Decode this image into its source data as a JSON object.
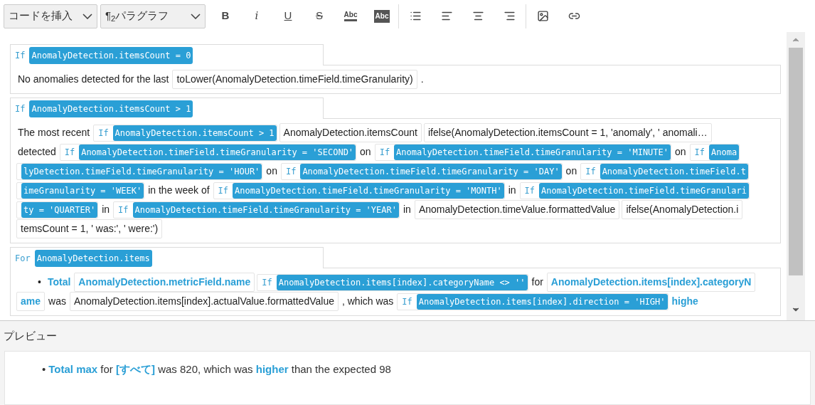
{
  "toolbar": {
    "selects": [
      {
        "label": "コードを挿入"
      },
      {
        "label": "¶$_{2}$パラグラフ"
      }
    ],
    "buttons": [
      {
        "kind": "bold",
        "label": "B"
      },
      {
        "kind": "italic",
        "label": "i"
      },
      {
        "kind": "underline",
        "label": "U"
      },
      {
        "kind": "strike",
        "label": "S"
      },
      {
        "kind": "text-color",
        "label": "Abc"
      },
      {
        "kind": "highlight",
        "label": "Abc"
      },
      {
        "kind": "list"
      },
      {
        "kind": "align-left"
      },
      {
        "kind": "align-center"
      },
      {
        "kind": "align-right"
      },
      {
        "kind": "image"
      },
      {
        "kind": "link"
      }
    ]
  },
  "editor": {
    "blocks": [
      {
        "keyword": "If",
        "condition": "AnomalyDetection.itemsCount = 0",
        "lines": [
          [
            {
              "kind": "text",
              "text": "No anomalies detected for the last"
            },
            {
              "kind": "expr",
              "text": "toLower(AnomalyDetection.timeField.timeGranularity)"
            },
            {
              "kind": "text",
              "text": "."
            }
          ]
        ]
      },
      {
        "keyword": "If",
        "condition": "AnomalyDetection.itemsCount > 1",
        "lines": [
          [
            {
              "kind": "text",
              "text": "The most recent"
            },
            {
              "kind": "cond",
              "keyword": "If",
              "text": "AnomalyDetection.itemsCount > 1"
            },
            {
              "kind": "expr",
              "text": "AnomalyDetection.itemsCount"
            },
            {
              "kind": "expr",
              "text": "ifelse(AnomalyDetection.itemsCount = 1, 'anomaly', ' anomali…"
            }
          ],
          [
            {
              "kind": "text",
              "text": "detected"
            },
            {
              "kind": "cond",
              "keyword": "If",
              "text": "AnomalyDetection.timeField.timeGranularity = 'SECOND'"
            },
            {
              "kind": "text",
              "text": "on"
            },
            {
              "kind": "cond",
              "keyword": "If",
              "text": "AnomalyDetection.timeField.timeGranularity = 'MINUTE'"
            },
            {
              "kind": "text",
              "text": "on"
            },
            {
              "kind": "cond",
              "keyword": "If",
              "text": "Anoma"
            }
          ],
          [
            {
              "kind": "cond",
              "text": "lyDetection.timeField.timeGranularity = 'HOUR'"
            },
            {
              "kind": "text",
              "text": "on"
            },
            {
              "kind": "cond",
              "keyword": "If",
              "text": "AnomalyDetection.timeField.timeGranularity = 'DAY'"
            },
            {
              "kind": "text",
              "text": "on"
            },
            {
              "kind": "cond",
              "keyword": "If",
              "text": "AnomalyDetection.timeField.t"
            }
          ],
          [
            {
              "kind": "cond",
              "text": "imeGranularity = 'WEEK'"
            },
            {
              "kind": "text",
              "text": "in the week of"
            },
            {
              "kind": "cond",
              "keyword": "If",
              "text": "AnomalyDetection.timeField.timeGranularity = 'MONTH'"
            },
            {
              "kind": "text",
              "text": "in"
            },
            {
              "kind": "cond",
              "keyword": "If",
              "text": "AnomalyDetection.timeField.timeGranulari"
            }
          ],
          [
            {
              "kind": "cond",
              "text": "ty = 'QUARTER'"
            },
            {
              "kind": "text",
              "text": "in"
            },
            {
              "kind": "cond",
              "keyword": "If",
              "text": "AnomalyDetection.timeField.timeGranularity = 'YEAR'"
            },
            {
              "kind": "text",
              "text": "in"
            },
            {
              "kind": "expr",
              "text": "AnomalyDetection.timeValue.formattedValue"
            },
            {
              "kind": "expr",
              "text": "ifelse(AnomalyDetection.i"
            }
          ],
          [
            {
              "kind": "expr",
              "text": "temsCount = 1, ' was:', ' were:')"
            }
          ]
        ]
      },
      {
        "keyword": "For",
        "condition": "AnomalyDetection.items",
        "lines": [
          [
            {
              "kind": "bullet",
              "text": "•"
            },
            {
              "kind": "bold",
              "text": "Total"
            },
            {
              "kind": "bold-expr",
              "text": "AnomalyDetection.metricField.name"
            },
            {
              "kind": "cond",
              "keyword": "If",
              "text": "AnomalyDetection.items[index].categoryName <> ''"
            },
            {
              "kind": "text",
              "text": "for"
            },
            {
              "kind": "bold-expr",
              "text": "AnomalyDetection.items[index].categoryN"
            }
          ],
          [
            {
              "kind": "bold-expr",
              "text": "ame"
            },
            {
              "kind": "text",
              "text": "was"
            },
            {
              "kind": "expr",
              "text": "AnomalyDetection.items[index].actualValue.formattedValue"
            },
            {
              "kind": "text",
              "text": ", which was"
            },
            {
              "kind": "cond",
              "keyword": "If",
              "text": "AnomalyDetection.items[index].direction = 'HIGH'"
            },
            {
              "kind": "bold",
              "text": "highe"
            }
          ]
        ]
      }
    ]
  },
  "preview": {
    "title": "プレビュー",
    "bullet": "•",
    "text": "**Total max** for **[すべて]** was 820, which was **higher** than the expected 98"
  }
}
